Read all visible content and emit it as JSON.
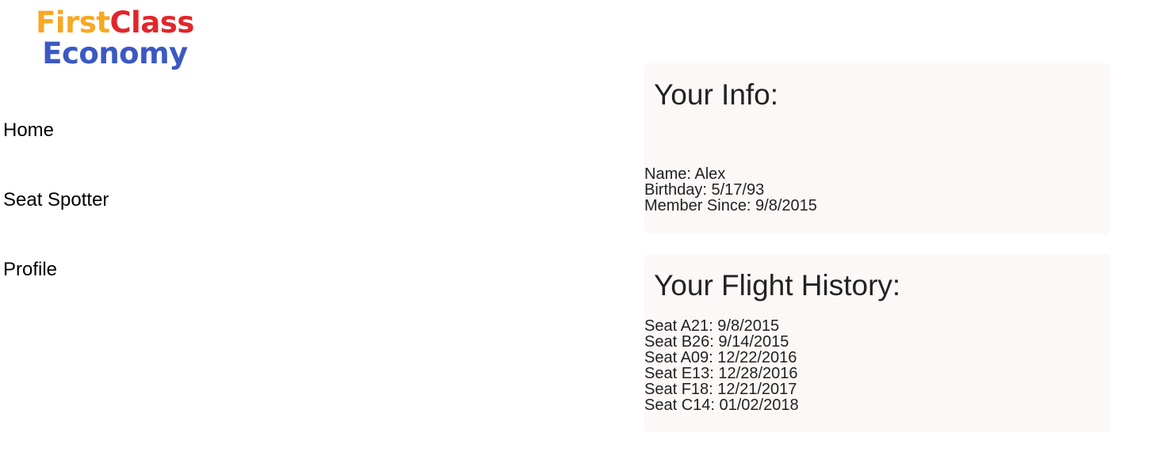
{
  "logo": {
    "first": "First",
    "class": "Class",
    "economy": "Economy"
  },
  "nav": {
    "items": [
      {
        "label": "Home"
      },
      {
        "label": "Seat Spotter"
      },
      {
        "label": "Profile"
      }
    ]
  },
  "info": {
    "title": "Your Info:",
    "lines": [
      "Name: Alex",
      "Birthday: 5/17/93",
      "Member Since: 9/8/2015"
    ]
  },
  "history": {
    "title": "Your Flight History:",
    "lines": [
      "Seat A21: 9/8/2015",
      "Seat B26: 9/14/2015",
      "Seat A09: 12/22/2016",
      "Seat E13: 12/28/2016",
      "Seat F18: 12/21/2017",
      "Seat C14: 01/02/2018"
    ]
  },
  "colors": {
    "logo_first": "#f7a823",
    "logo_class": "#e2262b",
    "logo_economy": "#3b59c2",
    "card_background": "#fcf8f7"
  }
}
